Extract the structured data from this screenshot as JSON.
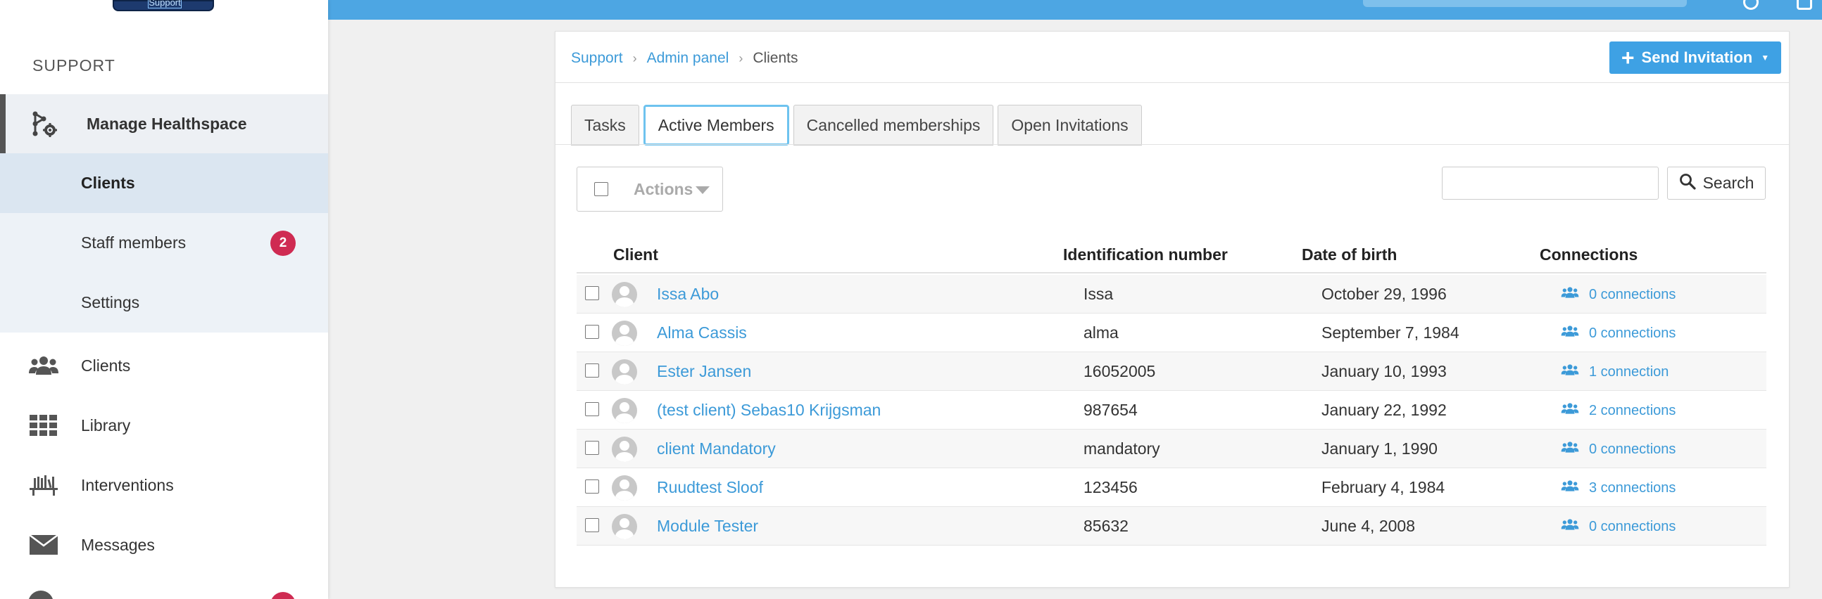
{
  "sidebar": {
    "logo_text": "Support",
    "section_title": "SUPPORT",
    "manage_label": "Manage Healthspace",
    "sub_items": [
      {
        "label": "Clients"
      },
      {
        "label": "Staff members",
        "badge": "2"
      },
      {
        "label": "Settings"
      }
    ],
    "items": [
      {
        "label": "Clients",
        "icon": "users-icon"
      },
      {
        "label": "Library",
        "icon": "grid-icon"
      },
      {
        "label": "Interventions",
        "icon": "bookshelf-icon"
      },
      {
        "label": "Messages",
        "icon": "envelope-icon"
      }
    ]
  },
  "breadcrumb": {
    "items": [
      "Support",
      "Admin panel"
    ],
    "current": "Clients"
  },
  "invite_button": {
    "label": "Send Invitation"
  },
  "tabs": [
    "Tasks",
    "Active Members",
    "Cancelled memberships",
    "Open Invitations"
  ],
  "toolbar": {
    "actions_label": "Actions",
    "search_value": "",
    "search_label": "Search"
  },
  "table": {
    "headers": [
      "Client",
      "Identification number",
      "Date of birth",
      "Connections"
    ],
    "rows": [
      {
        "name": "Issa Abo",
        "id": "Issa",
        "dob": "October 29, 1996",
        "connections": "0 connections"
      },
      {
        "name": "Alma Cassis",
        "id": "alma",
        "dob": "September 7, 1984",
        "connections": "0 connections"
      },
      {
        "name": "Ester Jansen",
        "id": "16052005",
        "dob": "January 10, 1993",
        "connections": "1 connection"
      },
      {
        "name": "(test client) Sebas10 Krijgsman",
        "id": "987654",
        "dob": "January 22, 1992",
        "connections": "2 connections"
      },
      {
        "name": "client Mandatory",
        "id": "mandatory",
        "dob": "January 1, 1990",
        "connections": "0 connections"
      },
      {
        "name": "Ruudtest Sloof",
        "id": "123456",
        "dob": "February 4, 1984",
        "connections": "3 connections"
      },
      {
        "name": "Module Tester",
        "id": "85632",
        "dob": "June 4, 2008",
        "connections": "0 connections"
      }
    ]
  },
  "colors": {
    "primary": "#3ea1e4",
    "link": "#3c9ad8",
    "badge": "#cf2b52",
    "active_tab_border": "#6ec3ef"
  }
}
